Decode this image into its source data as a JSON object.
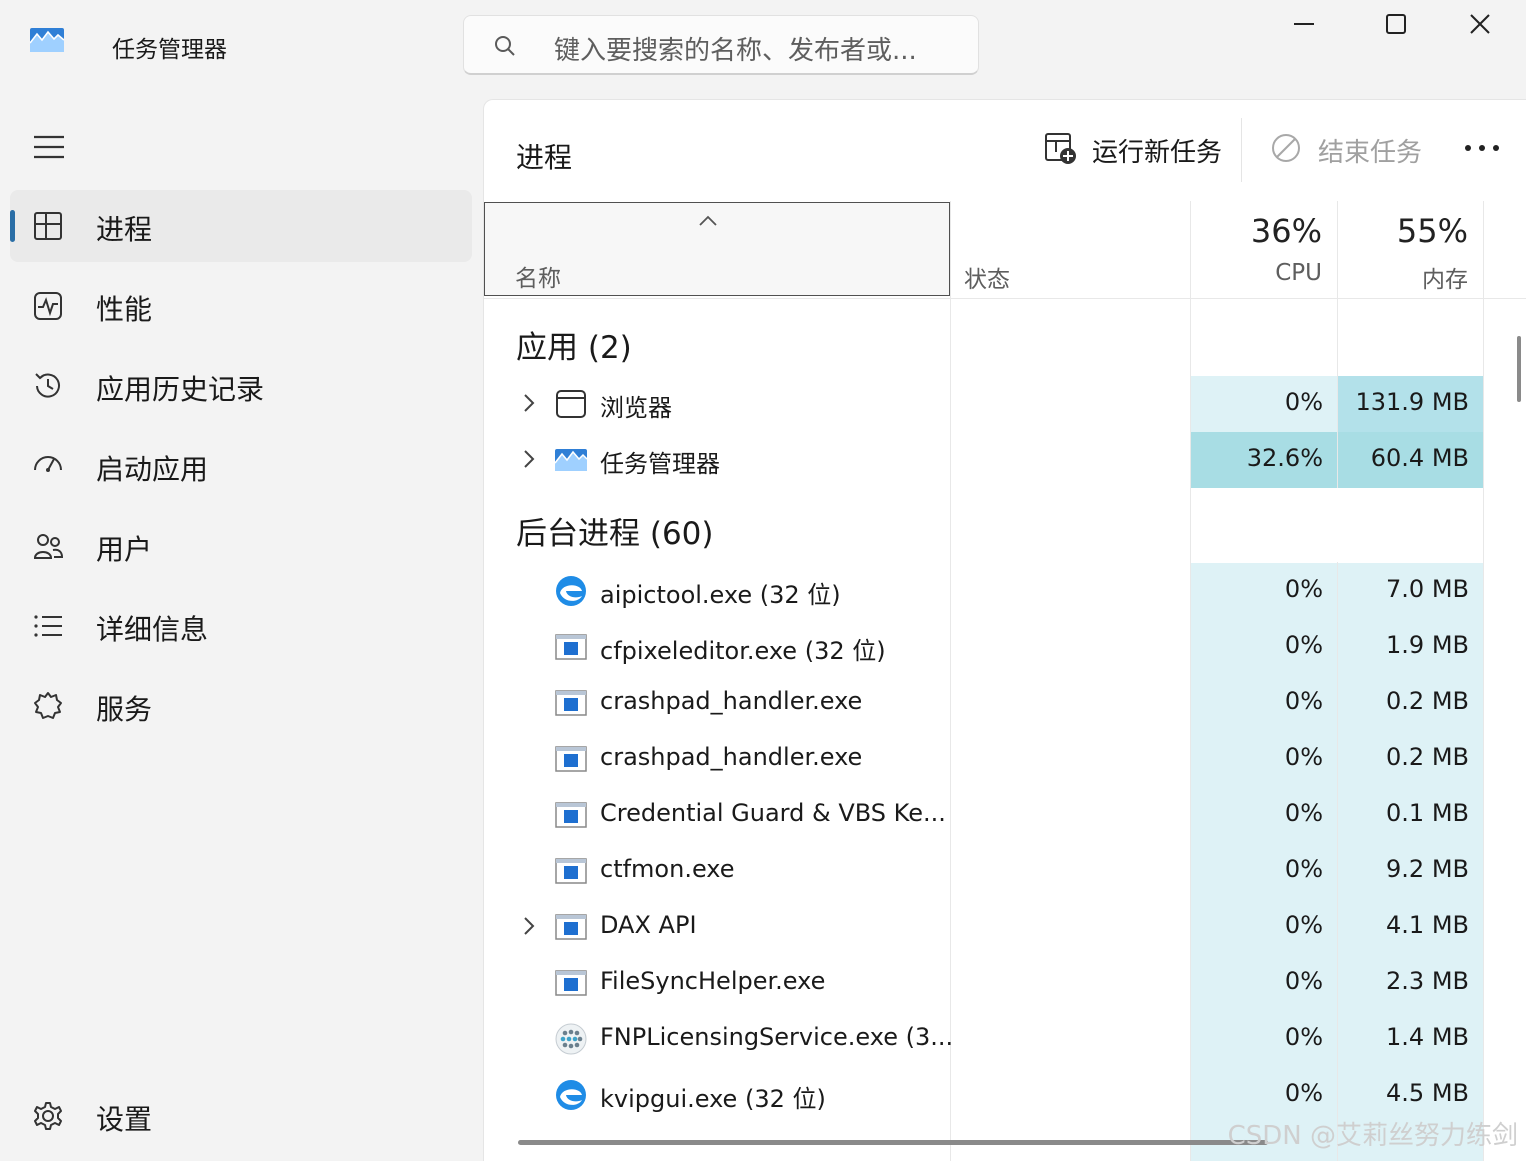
{
  "app": {
    "title": "任务管理器"
  },
  "search": {
    "placeholder": "键入要搜索的名称、发布者或..."
  },
  "sidebar": {
    "items": [
      {
        "label": "进程",
        "icon": "processes-icon",
        "active": true
      },
      {
        "label": "性能",
        "icon": "performance-icon"
      },
      {
        "label": "应用历史记录",
        "icon": "app-history-icon"
      },
      {
        "label": "启动应用",
        "icon": "startup-apps-icon"
      },
      {
        "label": "用户",
        "icon": "users-icon"
      },
      {
        "label": "详细信息",
        "icon": "details-icon"
      },
      {
        "label": "服务",
        "icon": "services-icon"
      }
    ],
    "settings_label": "设置"
  },
  "toolbar": {
    "page_title": "进程",
    "run_new_task": "运行新任务",
    "end_task": "结束任务"
  },
  "columns": {
    "name": "名称",
    "status": "状态",
    "cpu_percent": "36%",
    "cpu_label": "CPU",
    "memory_percent": "55%",
    "memory_label": "内存"
  },
  "groups": [
    {
      "title": "应用 (2)",
      "rows": [
        {
          "name": "浏览器",
          "icon": "browser-window-icon",
          "expandable": true,
          "cpu": "0%",
          "memory": "131.9 MB"
        },
        {
          "name": "任务管理器",
          "icon": "task-manager-icon",
          "expandable": true,
          "cpu": "32.6%",
          "memory": "60.4 MB"
        }
      ]
    },
    {
      "title": "后台进程 (60)",
      "rows": [
        {
          "name": "aipictool.exe (32 位)",
          "icon": "edge-like-app-icon",
          "expandable": false,
          "cpu": "0%",
          "memory": "7.0 MB"
        },
        {
          "name": "cfpixeleditor.exe (32 位)",
          "icon": "generic-exe-icon",
          "expandable": false,
          "cpu": "0%",
          "memory": "1.9 MB"
        },
        {
          "name": "crashpad_handler.exe",
          "icon": "generic-exe-icon",
          "expandable": false,
          "cpu": "0%",
          "memory": "0.2 MB"
        },
        {
          "name": "crashpad_handler.exe",
          "icon": "generic-exe-icon",
          "expandable": false,
          "cpu": "0%",
          "memory": "0.2 MB"
        },
        {
          "name": "Credential Guard & VBS Ke...",
          "icon": "generic-exe-icon",
          "expandable": false,
          "cpu": "0%",
          "memory": "0.1 MB"
        },
        {
          "name": "ctfmon.exe",
          "icon": "generic-exe-icon",
          "expandable": false,
          "cpu": "0%",
          "memory": "9.2 MB"
        },
        {
          "name": "DAX API",
          "icon": "generic-exe-icon",
          "expandable": true,
          "cpu": "0%",
          "memory": "4.1 MB"
        },
        {
          "name": "FileSyncHelper.exe",
          "icon": "generic-exe-icon",
          "expandable": false,
          "cpu": "0%",
          "memory": "2.3 MB"
        },
        {
          "name": "FNPLicensingService.exe (3...",
          "icon": "dots-app-icon",
          "expandable": false,
          "cpu": "0%",
          "memory": "1.4 MB"
        },
        {
          "name": "kvipgui.exe (32 位)",
          "icon": "edge-like-app-icon",
          "expandable": false,
          "cpu": "0%",
          "memory": "4.5 MB"
        }
      ]
    }
  ],
  "watermark": "CSDN @艾莉丝努力练剑",
  "colors": {
    "heat_light": "#def2f6",
    "heat_mid": "#b3e1ea",
    "heat_strong": "#a8dde4",
    "accent": "#2a6ea6"
  }
}
